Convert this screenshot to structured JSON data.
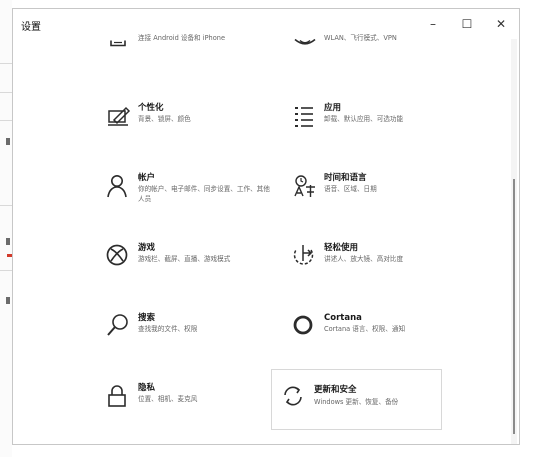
{
  "window": {
    "title": "设置",
    "controls": {
      "minimize": "–",
      "maximize": "☐",
      "close": "✕"
    }
  },
  "settings": {
    "top_partial": [
      {
        "title": "",
        "desc": "连接 Android 设备和 iPhone",
        "icon": "phone-link-icon"
      },
      {
        "title": "",
        "desc": "WLAN、飞行模式、VPN",
        "icon": "wifi-icon"
      }
    ],
    "items": [
      {
        "title": "个性化",
        "desc": "背景、锁屏、颜色",
        "icon": "personalization-icon"
      },
      {
        "title": "应用",
        "desc": "卸载、默认应用、可选功能",
        "icon": "apps-list-icon"
      },
      {
        "title": "帐户",
        "desc": "你的帐户、电子邮件、同步设置、工作、其他人员",
        "icon": "account-icon"
      },
      {
        "title": "时间和语言",
        "desc": "语音、区域、日期",
        "icon": "time-language-icon"
      },
      {
        "title": "游戏",
        "desc": "游戏栏、截屏、直播、游戏模式",
        "icon": "xbox-icon"
      },
      {
        "title": "轻松使用",
        "desc": "讲述人、放大镜、高对比度",
        "icon": "ease-of-access-icon"
      },
      {
        "title": "搜索",
        "desc": "查找我的文件、权限",
        "icon": "search-icon"
      },
      {
        "title": "Cortana",
        "desc": "Cortana 语言、权限、通知",
        "icon": "cortana-ring-icon"
      },
      {
        "title": "隐私",
        "desc": "位置、相机、麦克风",
        "icon": "lock-icon"
      },
      {
        "title": "更新和安全",
        "desc": "Windows 更新、恢复、备份",
        "icon": "sync-icon"
      }
    ]
  }
}
